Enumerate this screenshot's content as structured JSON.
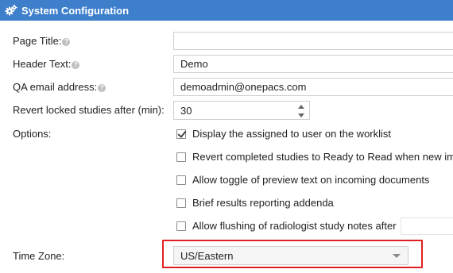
{
  "window": {
    "title": "System Configuration",
    "icon": "gears-icon"
  },
  "fields": {
    "page_title": {
      "label": "Page Title:",
      "value": ""
    },
    "header_text": {
      "label": "Header Text:",
      "value": "Demo"
    },
    "qa_email": {
      "label": "QA email address:",
      "value": "demoadmin@onepacs.com"
    },
    "revert_locked": {
      "label": "Revert locked studies after (min):",
      "value": "30"
    }
  },
  "options": {
    "label": "Options:",
    "items": [
      {
        "label": "Display the assigned to user on the worklist",
        "checked": true
      },
      {
        "label": "Revert completed studies to Ready to Read when new im",
        "checked": false
      },
      {
        "label": "Allow toggle of preview text on incoming documents",
        "checked": false
      },
      {
        "label": "Brief results reporting addenda",
        "checked": false
      },
      {
        "label": "Allow flushing of radiologist study notes after",
        "checked": false
      }
    ]
  },
  "timezone": {
    "label": "Time Zone:",
    "value": "US/Eastern"
  },
  "colors": {
    "titlebar": "#3d7fcb",
    "highlight": "#e02020"
  }
}
